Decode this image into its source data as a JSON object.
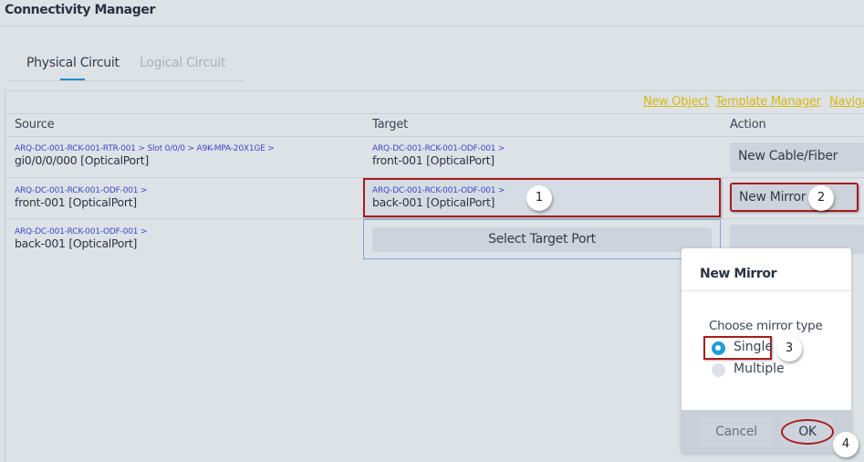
{
  "app": {
    "title": "Connectivity Manager"
  },
  "tabs": [
    {
      "label": "Physical Circuit",
      "active": true
    },
    {
      "label": "Logical Circuit",
      "active": false
    }
  ],
  "links": {
    "new_object": "New Object",
    "template_manager": "Template Manager",
    "navigate": "Naviga"
  },
  "table": {
    "headers": {
      "source": "Source",
      "target": "Target",
      "action": "Action"
    },
    "rows": [
      {
        "source_path": "ARQ-DC-001-RCK-001-RTR-001 > Slot 0/0/0 > A9K-MPA-20X1GE >",
        "source_port": "gi0/0/0/000 [OpticalPort]",
        "target_path": "ARQ-DC-001-RCK-001-ODF-001 >",
        "target_port": "front-001 [OpticalPort]",
        "action": "New Cable/Fiber"
      },
      {
        "source_path": "ARQ-DC-001-RCK-001-ODF-001 >",
        "source_port": "front-001 [OpticalPort]",
        "target_path": "ARQ-DC-001-RCK-001-ODF-001 >",
        "target_port": "back-001 [OpticalPort]",
        "action": "New Mirror"
      },
      {
        "source_path": "ARQ-DC-001-RCK-001-ODF-001 >",
        "source_port": "back-001 [OpticalPort]",
        "target_button": "Select Target Port"
      }
    ]
  },
  "dialog": {
    "title": "New Mirror",
    "prompt": "Choose mirror type",
    "options": [
      {
        "label": "Single",
        "selected": true
      },
      {
        "label": "Multiple",
        "selected": false
      }
    ],
    "cancel": "Cancel",
    "ok": "OK"
  },
  "badges": [
    "1",
    "2",
    "3",
    "4"
  ],
  "colors": {
    "accent": "#1e8fd0",
    "link": "#d9b90f",
    "path": "#3a49c9",
    "highlight": "#a91c1c"
  }
}
